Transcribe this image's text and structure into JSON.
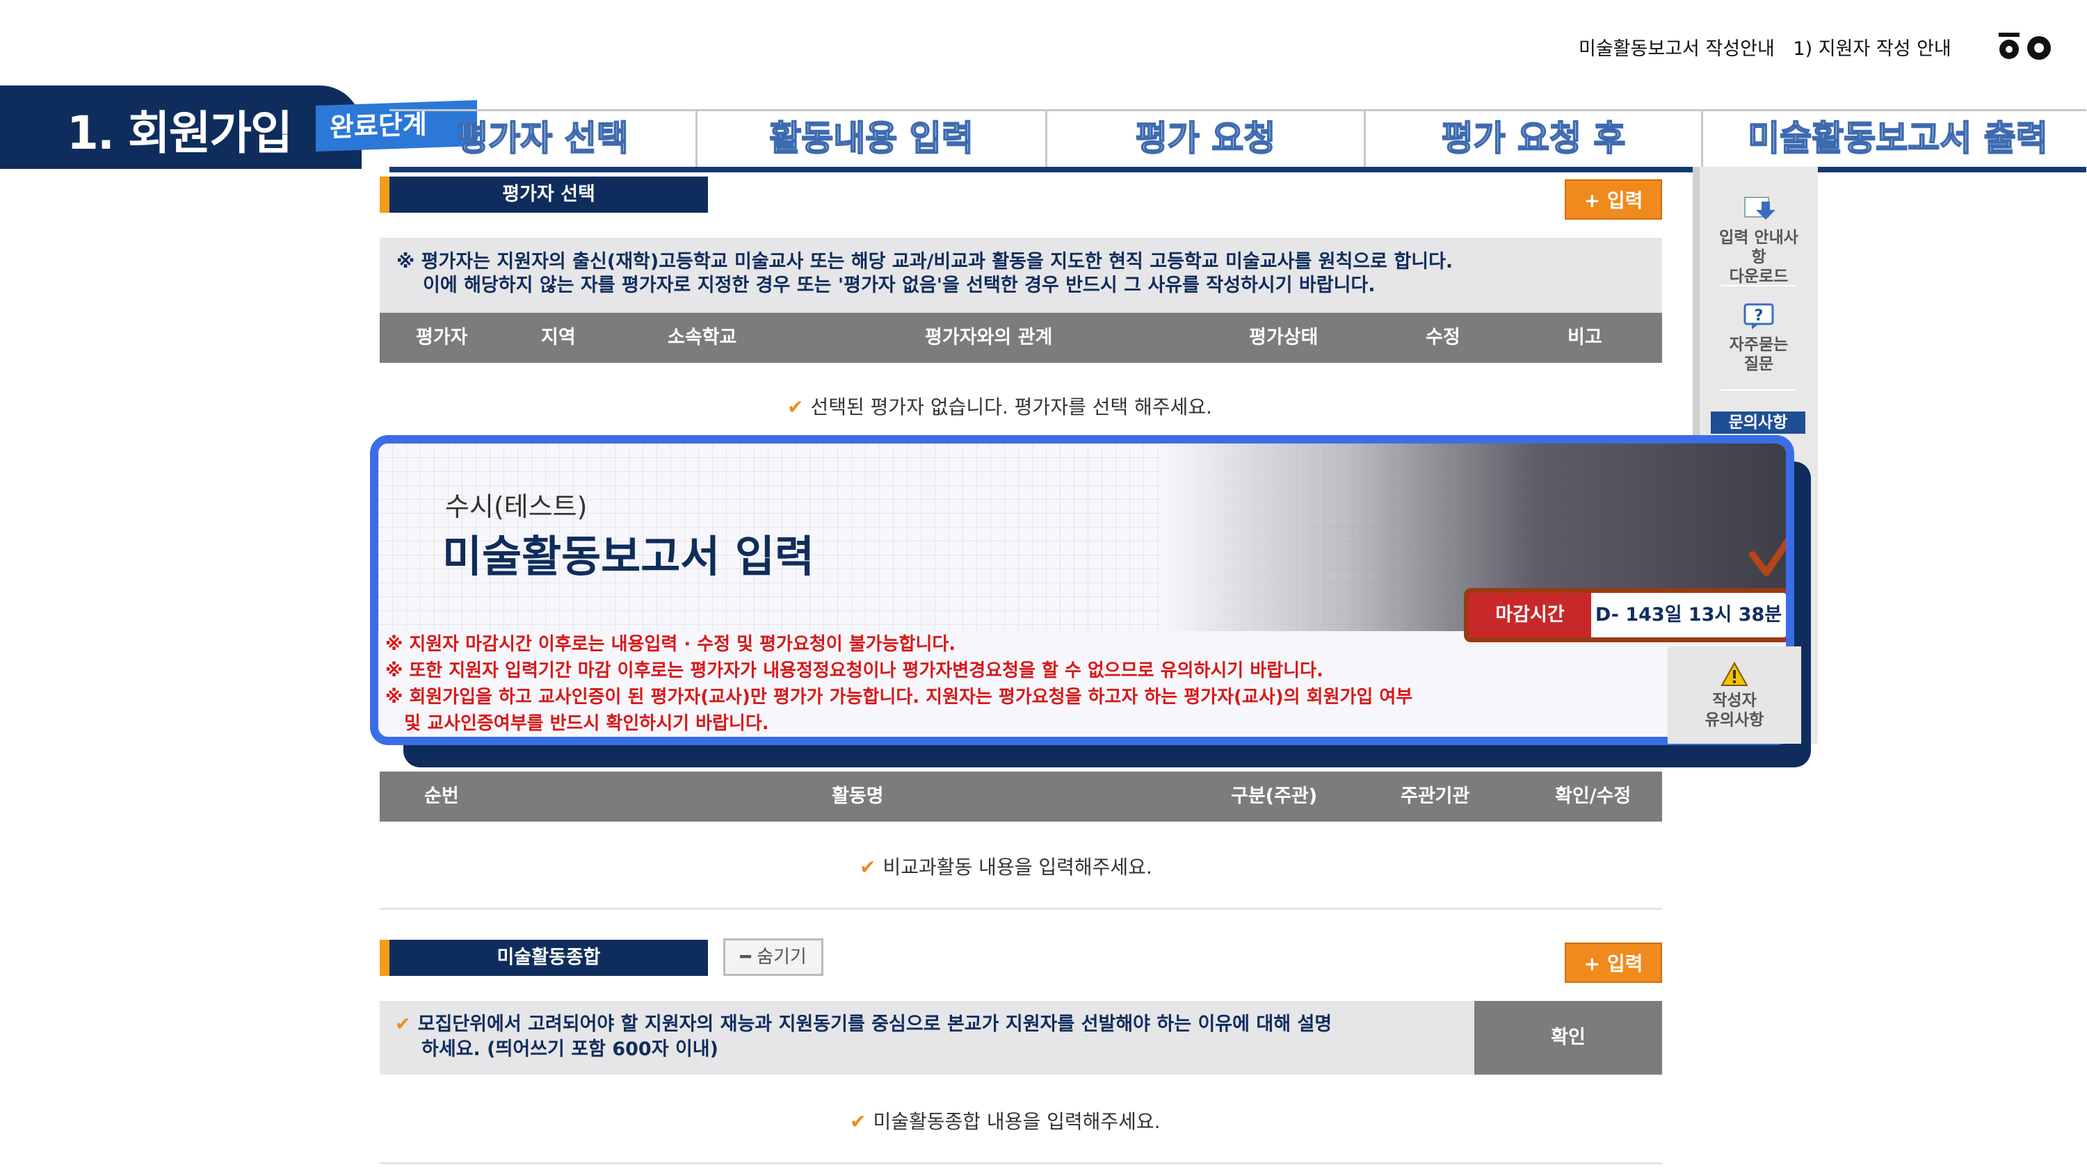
{
  "breadcrumb": {
    "item1": "미술활동보고서 작성안내",
    "item2": "1) 지원자 작성 안내"
  },
  "section_banner": {
    "title": "1. 회원가입",
    "tag": "완료단계"
  },
  "steps": [
    "평가자 선택",
    "활동내용 입력",
    "평가 요청",
    "평가 요청 후",
    "미술활동보고서 출력"
  ],
  "evaluator": {
    "header": "평가자 선택",
    "add_label": "입력",
    "notice_line1": "※ 평가자는 지원자의 출신(재학)고등학교 미술교사 또는 해당 교과/비교과 활동을 지도한 현직 고등학교 미술교사를 원칙으로 합니다.",
    "notice_line2": "이에 해당하지 않는 자를 평가자로 지정한 경우 또는 '평가자 없음'을 선택한 경우 반드시 그 사유를 작성하시기 바랍니다.",
    "columns": [
      "평가자",
      "지역",
      "소속학교",
      "평가자와의 관계",
      "평가상태",
      "수정",
      "비고"
    ],
    "empty_message": "선택된 평가자 없습니다. 평가자를 선택 해주세요."
  },
  "side_panel": {
    "download_label_1": "입력 안내사항",
    "download_label_2": "다운로드",
    "faq_label_1": "자주묻는",
    "faq_label_2": "질문",
    "qa_label": "문의사항",
    "warn_label_1": "작성자",
    "warn_label_2": "유의사항"
  },
  "popup": {
    "subtitle": "수시(테스트)",
    "title": "미술활동보고서 입력",
    "deadline_label": "마감시간",
    "deadline_value": "D- 143일 13시 38분",
    "notes": [
      "※ 지원자 마감시간 이후로는 내용입력 · 수정 및 평가요청이 불가능합니다.",
      "※ 또한 지원자 입력기간 마감 이후로는 평가자가 내용정정요청이나 평가자변경요청을 할 수 없으므로 유의하시기 바랍니다.",
      "※ 회원가입을 하고 교사인증이 된 평가자(교사)만 평가가 가능합니다. 지원자는 평가요청을 하고자 하는 평가자(교사)의 회원가입 여부",
      "   및 교사인증여부를 반드시 확인하시기 바랍니다."
    ]
  },
  "activity": {
    "columns": [
      "순번",
      "활동명",
      "구분(주관)",
      "주관기관",
      "확인/수정"
    ],
    "empty_message": "비교과활동 내용을 입력해주세요."
  },
  "summary": {
    "header": "미술활동종합",
    "hide_label": "숨기기",
    "add_label": "입력",
    "question_line1": "모집단위에서 고려되어야 할 지원자의 재능과 지원동기를 중심으로 본교가 지원자를 선발해야 하는 이유에 대해 설명",
    "question_line2": "하세요. (띄어쓰기 포함 600자 이내)",
    "confirm_label": "확인",
    "empty_message": "미술활동종합 내용을 입력해주세요."
  }
}
